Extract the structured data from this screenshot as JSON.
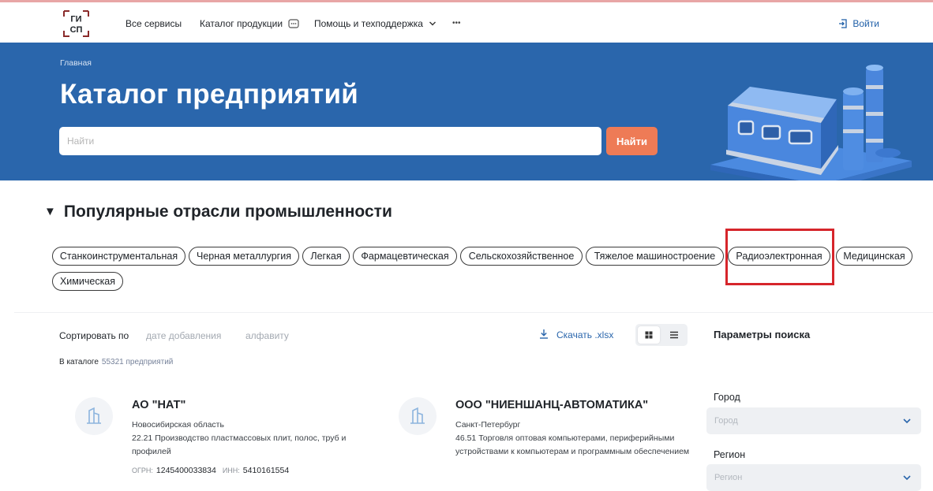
{
  "nav": {
    "items": [
      "Все сервисы",
      "Каталог продукции",
      "Помощь и техподдержка"
    ],
    "more": "•••",
    "login": "Войти"
  },
  "hero": {
    "breadcrumb": "Главная",
    "title": "Каталог предприятий",
    "search_placeholder": "Найти",
    "search_button": "Найти"
  },
  "industries": {
    "title": "Популярные отрасли промышленности",
    "chips": [
      "Станкоинструментальная",
      "Черная металлургия",
      "Легкая",
      "Фармацевтическая",
      "Сельскохозяйственное",
      "Тяжелое машиностроение",
      "Радиоэлектронная",
      "Медицинская",
      "Химическая"
    ],
    "highlighted": "Радиоэлектронная"
  },
  "sort": {
    "label": "Сортировать по",
    "options": [
      "дате добавления",
      "алфавиту"
    ],
    "download": "Скачать .xlsx"
  },
  "catalog": {
    "count_label": "В каталоге",
    "count_value": "55321 предприятий"
  },
  "companies": [
    {
      "name": "АО \"НАТ\"",
      "region": "Новосибирская область",
      "okved": "22.21 Производство пластмассовых плит, полос, труб и профилей",
      "ogrn_label": "ОГРН:",
      "ogrn": "1245400033834",
      "inn_label": "ИНН:",
      "inn": "5410161554"
    },
    {
      "name": "ООО \"НИЕНШАНЦ-АВТОМАТИКА\"",
      "region": "Санкт-Петербург",
      "okved": "46.51 Торговля оптовая компьютерами, периферийными устройствами к компьютерам и программным обеспечением"
    }
  ],
  "filters": {
    "title": "Параметры поиска",
    "city_label": "Город",
    "city_placeholder": "Город",
    "region_label": "Регион",
    "region_placeholder": "Регион"
  },
  "colors": {
    "hero_bg": "#2a66ac",
    "accent_button": "#ee7b56",
    "link": "#1f5fa8",
    "highlight_border": "#d6252b"
  }
}
